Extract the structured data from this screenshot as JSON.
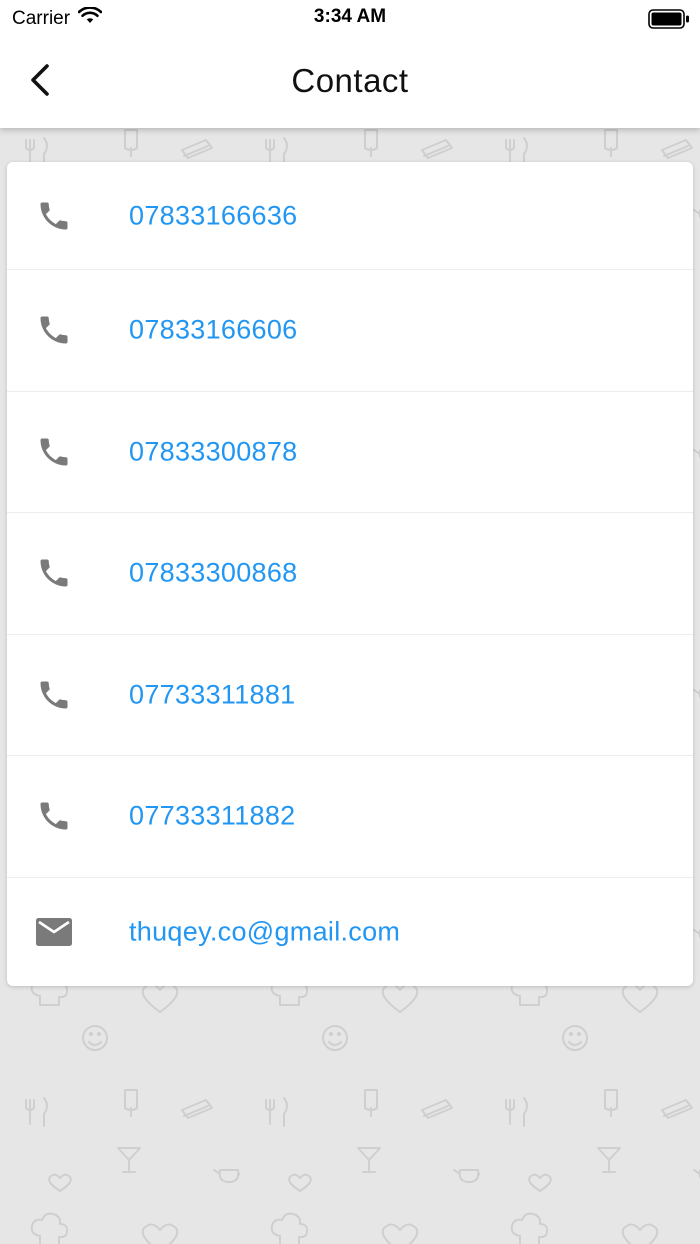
{
  "status_bar": {
    "carrier": "Carrier",
    "time": "3:34 AM"
  },
  "header": {
    "title": "Contact",
    "back_icon": "chevron-left-icon"
  },
  "contacts": [
    {
      "type": "phone",
      "icon": "phone-icon",
      "value": "07833166636"
    },
    {
      "type": "phone",
      "icon": "phone-icon",
      "value": "07833166606"
    },
    {
      "type": "phone",
      "icon": "phone-icon",
      "value": "07833300878"
    },
    {
      "type": "phone",
      "icon": "phone-icon",
      "value": "07833300868"
    },
    {
      "type": "phone",
      "icon": "phone-icon",
      "value": "07733311881"
    },
    {
      "type": "phone",
      "icon": "phone-icon",
      "value": "07733311882"
    },
    {
      "type": "email",
      "icon": "mail-icon",
      "value": "thuqey.co@gmail.com"
    }
  ],
  "colors": {
    "link": "#2196f3",
    "icon": "#7a7a7a",
    "background": "#e6e6e6",
    "card": "#ffffff"
  }
}
